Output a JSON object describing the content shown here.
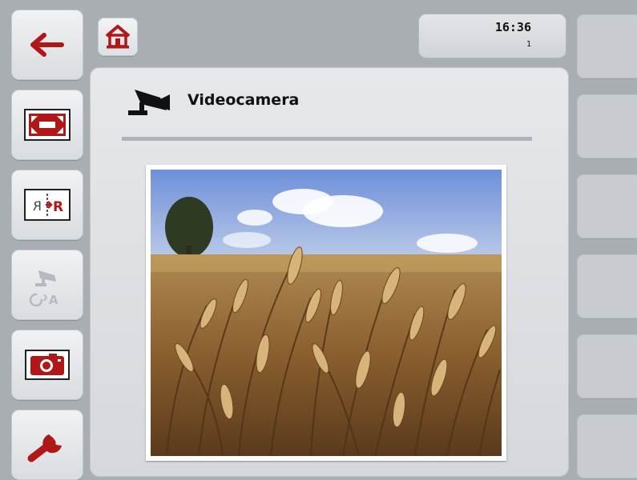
{
  "screen": {
    "title": "Videocamera",
    "clock": {
      "time": "16:36",
      "sub": "1"
    }
  },
  "softkeys_left": [
    {
      "name": "back-button",
      "icon": "back-arrow-icon"
    },
    {
      "name": "fullscreen-button",
      "icon": "fullscreen-icon"
    },
    {
      "name": "mirror-button",
      "icon": "mirror-image-icon"
    },
    {
      "name": "auto-camera-switch-button",
      "icon": "camera-auto-switch-icon",
      "disabled": true
    },
    {
      "name": "snapshot-button",
      "icon": "photo-camera-icon"
    },
    {
      "name": "settings-button",
      "icon": "wrench-icon"
    }
  ],
  "softkeys_right_count": 6,
  "colors": {
    "accent": "#b01818",
    "background": "#a9aeb3",
    "panel": "#e2e4e7"
  }
}
